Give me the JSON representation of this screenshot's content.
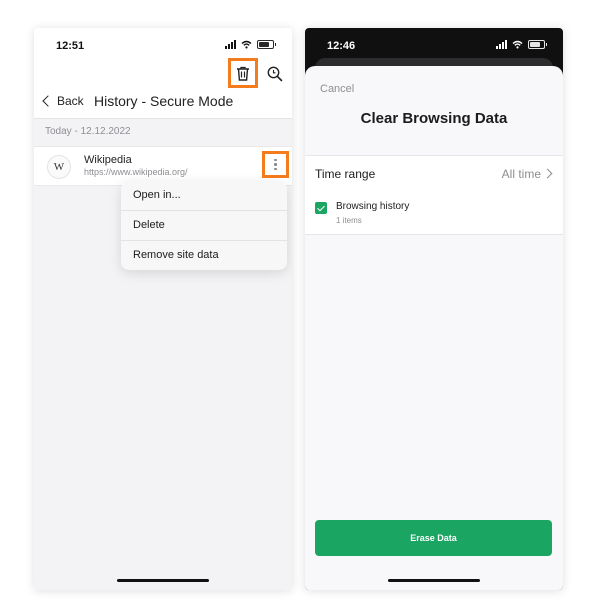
{
  "left_screen": {
    "status_time": "12:51",
    "back_label": "Back",
    "title": "History - Secure Mode",
    "date_header": "Today - 12.12.2022",
    "history_item": {
      "favicon_letter": "W",
      "name": "Wikipedia",
      "url": "https://www.wikipedia.org/"
    },
    "context_menu": [
      "Open in...",
      "Delete",
      "Remove site data"
    ],
    "icons": [
      "chevron-left-icon",
      "trash-icon",
      "history-search-icon",
      "more-vertical-icon"
    ],
    "highlight_color": "#f57c1c"
  },
  "right_screen": {
    "status_time": "12:46",
    "cancel_label": "Cancel",
    "title": "Clear Browsing Data",
    "time_range_label": "Time range",
    "time_range_value": "All time",
    "option": {
      "label": "Browsing history",
      "sub": "1 items",
      "checked": true
    },
    "erase_label": "Erase Data",
    "accent_color": "#1aa563"
  }
}
